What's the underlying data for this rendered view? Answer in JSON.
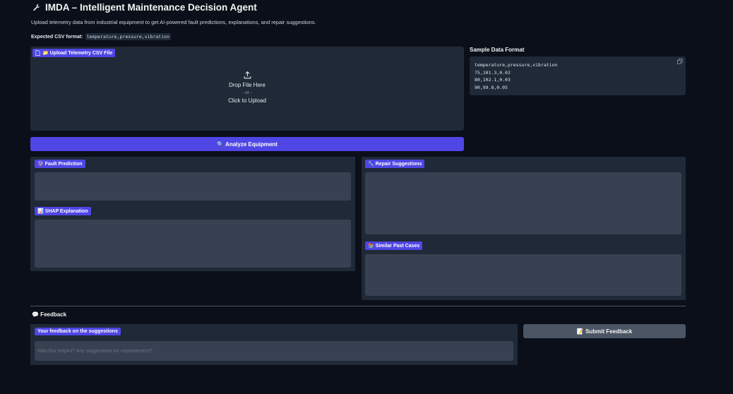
{
  "header": {
    "icon": "wrench-icon",
    "title": "IMDA – Intelligent Maintenance Decision Agent",
    "subtitle": "Upload telemetry data from industrial equipment to get AI-powered fault predictions, explanations, and repair suggestions.",
    "csv_label": "Expected CSV format:",
    "csv_format": "temperature,pressure,vibration"
  },
  "upload": {
    "label": "📁 Upload Telemetry CSV File",
    "drop_text": "Drop File Here",
    "or_text": "- or -",
    "click_text": "Click to Upload"
  },
  "analyze_button": "🔍 Analyze Equipment",
  "sample": {
    "label": "Sample Data Format",
    "lines": "temperature,pressure,vibration\n75,101.3,0.02\n80,102.1,0.03\n90,99.8,0.05"
  },
  "outputs": {
    "fault_prediction": "🔮 Fault Prediction",
    "shap_explanation": "📊 SHAP Explanation",
    "repair_suggestions": "🔧 Repair Suggestions",
    "similar_cases": "📚 Similar Past Cases"
  },
  "feedback": {
    "heading": "💬 Feedback",
    "label": "Your feedback on the suggestions",
    "placeholder": "Was this helpful? Any suggestions for improvement?",
    "value": "",
    "submit_label": "📝 Submit Feedback"
  },
  "colors": {
    "background": "#0b0f19",
    "panel": "#1f2937",
    "field": "#374151",
    "accent": "#4f46e5"
  }
}
